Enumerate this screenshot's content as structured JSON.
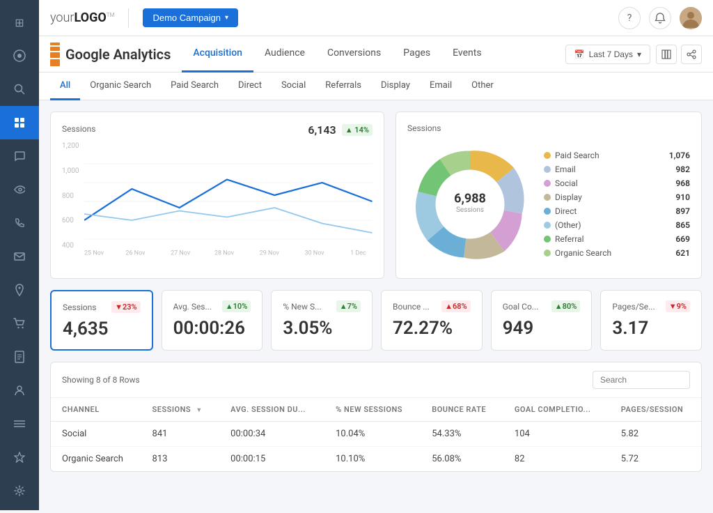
{
  "sidebar": {
    "icons": [
      {
        "name": "home-icon",
        "symbol": "⊞",
        "active": false
      },
      {
        "name": "analytics-icon",
        "symbol": "◉",
        "active": false
      },
      {
        "name": "search-icon",
        "symbol": "🔍",
        "active": false
      },
      {
        "name": "dashboard-icon",
        "symbol": "▦",
        "active": true
      },
      {
        "name": "chat-icon",
        "symbol": "💬",
        "active": false
      },
      {
        "name": "eye-icon",
        "symbol": "◎",
        "active": false
      },
      {
        "name": "phone-icon",
        "symbol": "📞",
        "active": false
      },
      {
        "name": "mail-icon",
        "symbol": "✉",
        "active": false
      },
      {
        "name": "location-icon",
        "symbol": "📍",
        "active": false
      },
      {
        "name": "cart-icon",
        "symbol": "🛒",
        "active": false
      },
      {
        "name": "report-icon",
        "symbol": "📄",
        "active": false
      },
      {
        "name": "user-icon",
        "symbol": "👤",
        "active": false
      },
      {
        "name": "list-icon",
        "symbol": "☰",
        "active": false
      },
      {
        "name": "plugin-icon",
        "symbol": "⚡",
        "active": false
      },
      {
        "name": "settings-icon",
        "symbol": "⚙",
        "active": false
      }
    ]
  },
  "header": {
    "logo_text": "your",
    "logo_bold": "LOGO",
    "logo_tm": "TM",
    "campaign_label": "Demo Campaign",
    "help_icon": "?",
    "notification_icon": "🔔"
  },
  "subnav": {
    "ga_title": "Google Analytics",
    "items": [
      {
        "label": "Acquisition",
        "active": true
      },
      {
        "label": "Audience",
        "active": false
      },
      {
        "label": "Conversions",
        "active": false
      },
      {
        "label": "Pages",
        "active": false
      },
      {
        "label": "Events",
        "active": false
      }
    ],
    "date_range": "Last 7 Days",
    "calendar_icon": "📅"
  },
  "tabbar": {
    "items": [
      {
        "label": "All",
        "active": true
      },
      {
        "label": "Organic Search",
        "active": false
      },
      {
        "label": "Paid Search",
        "active": false
      },
      {
        "label": "Direct",
        "active": false
      },
      {
        "label": "Social",
        "active": false
      },
      {
        "label": "Referrals",
        "active": false
      },
      {
        "label": "Display",
        "active": false
      },
      {
        "label": "Email",
        "active": false
      },
      {
        "label": "Other",
        "active": false
      }
    ]
  },
  "line_chart": {
    "title": "Sessions",
    "total": "6,143",
    "change": "▲ 14%",
    "change_type": "up",
    "x_labels": [
      "25 Nov",
      "26 Nov",
      "27 Nov",
      "28 Nov",
      "29 Nov",
      "30 Nov",
      "1 Dec"
    ],
    "y_labels": [
      "1,200",
      "1,000",
      "800",
      "600",
      "400"
    ]
  },
  "donut_chart": {
    "title": "Sessions",
    "center_value": "6,988",
    "center_label": "Sessions",
    "legend": [
      {
        "label": "Paid Search",
        "value": "1,076",
        "color": "#e8b84b"
      },
      {
        "label": "Email",
        "value": "982",
        "color": "#b0c4de"
      },
      {
        "label": "Social",
        "value": "968",
        "color": "#d4a0d4"
      },
      {
        "label": "Display",
        "value": "910",
        "color": "#c4b89a"
      },
      {
        "label": "Direct",
        "value": "897",
        "color": "#6baed6"
      },
      {
        "label": "(Other)",
        "value": "865",
        "color": "#9ecae1"
      },
      {
        "label": "Referral",
        "value": "669",
        "color": "#74c476"
      },
      {
        "label": "Organic Search",
        "value": "621",
        "color": "#a8d08d"
      }
    ]
  },
  "metrics": [
    {
      "name": "Sessions",
      "value": "4,635",
      "change": "▼23%",
      "change_type": "down",
      "active": true
    },
    {
      "name": "Avg. Ses...",
      "value": "00:00:26",
      "change": "▲10%",
      "change_type": "up",
      "active": false
    },
    {
      "name": "% New S...",
      "value": "3.05%",
      "change": "▲7%",
      "change_type": "up",
      "active": false
    },
    {
      "name": "Bounce ...",
      "value": "72.27%",
      "change": "▲68%",
      "change_type": "down",
      "active": false
    },
    {
      "name": "Goal Co...",
      "value": "949",
      "change": "▲80%",
      "change_type": "up",
      "active": false
    },
    {
      "name": "Pages/Se...",
      "value": "3.17",
      "change": "▼9%",
      "change_type": "down",
      "active": false
    }
  ],
  "table": {
    "info": "Showing 8 of 8 Rows",
    "search_placeholder": "Search",
    "columns": [
      {
        "label": "CHANNEL",
        "sortable": false
      },
      {
        "label": "SESSIONS",
        "sortable": true
      },
      {
        "label": "AVG. SESSION DU...",
        "sortable": false
      },
      {
        "label": "% NEW SESSIONS",
        "sortable": false
      },
      {
        "label": "BOUNCE RATE",
        "sortable": false
      },
      {
        "label": "GOAL COMPLETIO...",
        "sortable": false
      },
      {
        "label": "PAGES/SESSION",
        "sortable": false
      }
    ],
    "rows": [
      {
        "channel": "Social",
        "sessions": "841",
        "avg_session": "00:00:34",
        "new_sessions": "10.04%",
        "bounce_rate": "54.33%",
        "goal_completions": "104",
        "pages_session": "5.82"
      },
      {
        "channel": "Organic Search",
        "sessions": "813",
        "avg_session": "00:00:15",
        "new_sessions": "10.10%",
        "bounce_rate": "56.08%",
        "goal_completions": "82",
        "pages_session": "5.72"
      }
    ]
  },
  "colors": {
    "primary": "#1a6fd8",
    "accent_orange": "#e67e22",
    "line_dark": "#1a6fd8",
    "line_light": "#90c8f0",
    "sidebar_bg": "#2c3e50",
    "active_sidebar": "#1a6fd8"
  }
}
